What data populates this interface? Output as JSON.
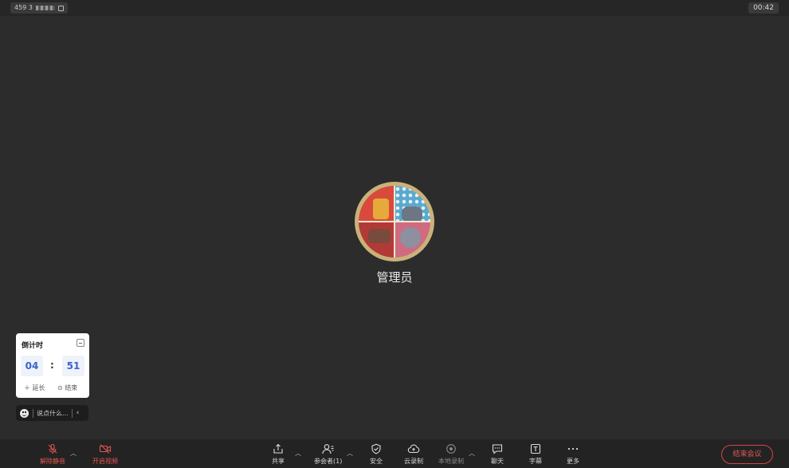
{
  "topbar": {
    "meeting_id_prefix": "459 3",
    "elapsed": "00:42"
  },
  "participant": {
    "name": "管理员"
  },
  "countdown": {
    "title": "倒计时",
    "minutes": "04",
    "colon": ":",
    "seconds": "51",
    "extend_label": "＋ 延长",
    "end_label": "⊙ 结束"
  },
  "chat_input": {
    "placeholder": "说点什么..."
  },
  "toolbar": {
    "unmute": "解除静音",
    "start_video": "开启视频",
    "share": "共享",
    "participants": "参会者(1)",
    "security": "安全",
    "cloud_record": "云录制",
    "local_record": "本地录制",
    "chat": "聊天",
    "captions": "字幕",
    "more": "更多",
    "end_meeting": "结束会议"
  },
  "colors": {
    "accent_red": "#e05550",
    "countdown_blue": "#3a63c9",
    "background": "#2c2c2c"
  }
}
